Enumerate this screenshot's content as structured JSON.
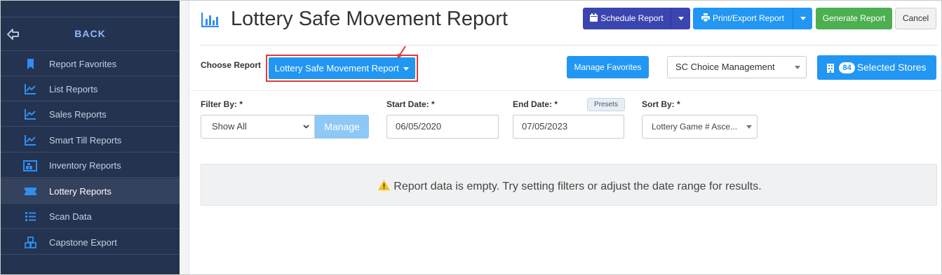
{
  "sidebar": {
    "back_label": "BACK",
    "items": [
      {
        "label": "Report Favorites",
        "icon": "bookmark-icon"
      },
      {
        "label": "List Reports",
        "icon": "line-chart-icon"
      },
      {
        "label": "Sales Reports",
        "icon": "line-chart-icon"
      },
      {
        "label": "Smart Till Reports",
        "icon": "line-chart-icon"
      },
      {
        "label": "Inventory Reports",
        "icon": "warehouse-icon"
      },
      {
        "label": "Lottery Reports",
        "icon": "ticket-icon"
      },
      {
        "label": "Scan Data",
        "icon": "list-icon"
      },
      {
        "label": "Capstone Export",
        "icon": "boxes-icon"
      }
    ],
    "active": "Lottery Reports"
  },
  "header": {
    "title": "Lottery Safe Movement Report",
    "schedule_label": "Schedule Report",
    "print_label": "Print/Export Report",
    "generate_label": "Generate Report",
    "cancel_label": "Cancel"
  },
  "report_bar": {
    "choose_label": "Choose Report",
    "selected_report": "Lottery Safe Movement Report",
    "favorites_label": "Manage Favorites",
    "store_group": "SC Choice Management",
    "store_count": "84",
    "stores_label": "Selected Stores"
  },
  "filters": {
    "filter_by_label": "Filter By: *",
    "filter_value": "Show All",
    "manage_label": "Manage",
    "start_label": "Start Date: *",
    "start_value": "06/05/2020",
    "end_label": "End Date: *",
    "end_value": "07/05/2023",
    "presets_label": "Presets",
    "sort_label": "Sort By: *",
    "sort_value": "Lottery Game # Asce..."
  },
  "empty_message": "Report data is empty. Try setting filters or adjust the date range for results.",
  "colors": {
    "sidebar_bg": "#243350",
    "primary": "#2196f3",
    "schedule": "#3a45b0",
    "generate": "#4caf50",
    "highlight_red": "#e53935",
    "warning": "#f5c518"
  }
}
